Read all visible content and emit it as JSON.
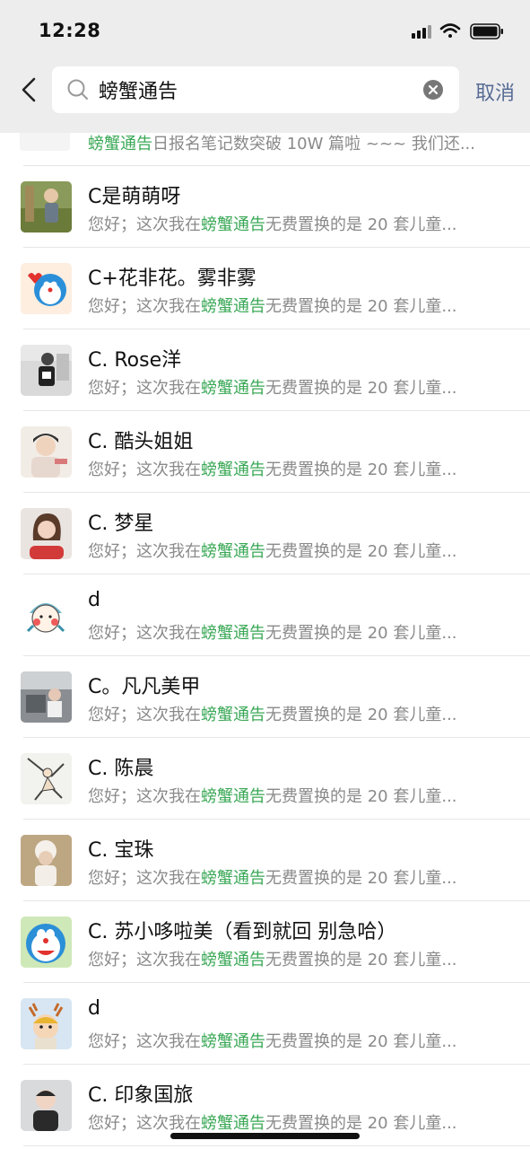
{
  "status": {
    "time": "12:28"
  },
  "search": {
    "query": "螃蟹通告",
    "cancel_label": "取消"
  },
  "first_result": {
    "snippet_highlight": "螃蟹通告",
    "snippet_rest": "日报名笔记数突破 10W 篇啦 ~~~ 我们还..."
  },
  "snippet_parts": {
    "prefix": "您好；这次我在",
    "highlight": "螃蟹通告",
    "suffix": "无费置换的是 20 套儿童..."
  },
  "results": [
    {
      "name": "C是萌萌呀",
      "avatar": "photo-child-outdoor-avatar"
    },
    {
      "name": "C+花非花。雾非雾",
      "avatar": "doraemon-heart-avatar"
    },
    {
      "name": "C. Rose洋",
      "avatar": "photo-child-black-white-avatar"
    },
    {
      "name": "C. 酷头姐姐",
      "avatar": "photo-girl-hat-avatar"
    },
    {
      "name": "C. 梦星",
      "avatar": "photo-woman-portrait-avatar"
    },
    {
      "name": "d",
      "avatar": "cartoon-blush-face-avatar"
    },
    {
      "name": "C。凡凡美甲",
      "avatar": "photo-room-avatar"
    },
    {
      "name": "C. 陈晨",
      "avatar": "cartoon-dancer-avatar"
    },
    {
      "name": "C. 宝珠",
      "avatar": "photo-child-winter-hat-avatar"
    },
    {
      "name": "C. 苏小哆啦美（看到就回 别急哈）",
      "avatar": "doraemon-face-avatar"
    },
    {
      "name": "d",
      "avatar": "cartoon-boy-deer-avatar"
    },
    {
      "name": "C. 印象国旅",
      "avatar": "photo-baby-avatar"
    }
  ],
  "colors": {
    "highlight": "#3aa856",
    "cancel": "#576b95",
    "header_bg": "#ededed"
  }
}
